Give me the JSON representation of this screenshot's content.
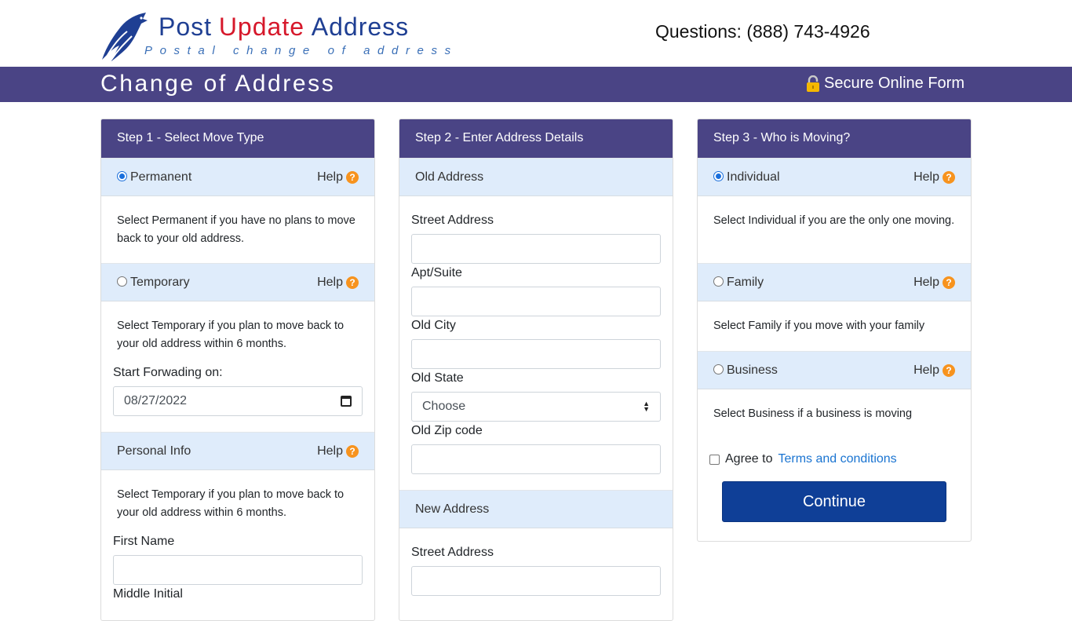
{
  "header": {
    "logo_word1": "Post",
    "logo_word2": "Update",
    "logo_word3": "Address",
    "logo_tagline": "Postal change of address",
    "phone": "Questions: (888) 743-4926"
  },
  "banner": {
    "title": "Change of Address",
    "secure_label": "Secure Online Form"
  },
  "step1": {
    "title": "Step 1 - Select Move Type",
    "help_label": "Help",
    "permanent_label": "Permanent",
    "permanent_desc": "Select Permanent if you have no plans to move back to your old address.",
    "temporary_label": "Temporary",
    "temporary_desc": "Select Temporary if you plan to move back to your old address within 6 months.",
    "start_forwarding_label": "Start Forwading on:",
    "start_forwarding_value": "08/27/2022",
    "personal_info_label": "Personal Info",
    "personal_info_desc": "Select Temporary if you plan to move back to your old address within 6 months.",
    "first_name_label": "First Name",
    "middle_initial_label": "Middle Initial"
  },
  "step2": {
    "title": "Step 2 - Enter Address Details",
    "old_address_label": "Old Address",
    "street_label": "Street Address",
    "apt_label": "Apt/Suite",
    "city_label": "Old City",
    "state_label": "Old State",
    "state_selected": "Choose",
    "zip_label": "Old Zip code",
    "new_address_label": "New Address",
    "new_street_label": "Street Address"
  },
  "step3": {
    "title": "Step 3 - Who is Moving?",
    "help_label": "Help",
    "individual_label": "Individual",
    "individual_desc": "Select Individual if you are the only one moving.",
    "family_label": "Family",
    "family_desc": "Select Family if you move with your family",
    "business_label": "Business",
    "business_desc": "Select Business if a business is moving",
    "agree_text": "Agree to",
    "terms_link": "Terms and conditions",
    "continue_label": "Continue"
  },
  "colors": {
    "brand_purple": "#4a4485",
    "option_bg": "#dfecfb",
    "help_orange": "#f7931e",
    "button_blue": "#0f3f97",
    "link_blue": "#1a74d1"
  },
  "icons": [
    "eagle-logo-icon",
    "lock-icon",
    "help-icon",
    "calendar-icon",
    "select-arrows-icon"
  ]
}
